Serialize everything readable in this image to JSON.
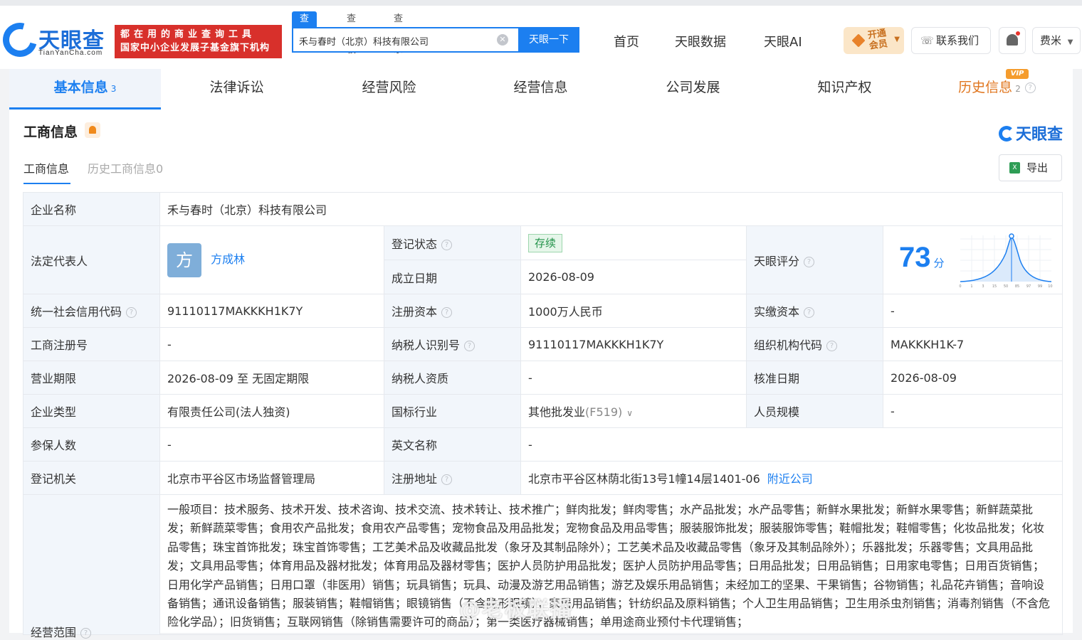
{
  "header": {
    "logo_text": "天眼查",
    "logo_sub": "TianYanCha.com",
    "banner_line1": "都在用的商业查询工具",
    "banner_line2": "国家中小企业发展子基金旗下机构",
    "search_tabs": [
      "查公司",
      "查老板",
      "查关系"
    ],
    "search_value": "禾与春时（北京）科技有限公司",
    "search_button": "天眼一下",
    "nav": [
      "首页",
      "天眼数据",
      "天眼AI"
    ],
    "vip_label_1": "开通",
    "vip_label_2": "会员",
    "contact": "联系我们",
    "user": "费米"
  },
  "tabs": [
    {
      "label": "基本信息",
      "count": "3"
    },
    {
      "label": "法律诉讼"
    },
    {
      "label": "经营风险"
    },
    {
      "label": "经营信息"
    },
    {
      "label": "公司发展"
    },
    {
      "label": "知识产权"
    },
    {
      "label": "历史信息",
      "count": "2",
      "badge": "VIP"
    }
  ],
  "panel": {
    "title": "工商信息",
    "brand": "天眼查",
    "subtabs": [
      "工商信息",
      "历史工商信息0"
    ],
    "export": "导出"
  },
  "info": {
    "company_name_label": "企业名称",
    "company_name": "禾与春时（北京）科技有限公司",
    "legal_rep_label": "法定代表人",
    "legal_rep_avatar": "方",
    "legal_rep": "方成林",
    "reg_status_label": "登记状态",
    "reg_status": "存续",
    "found_date_label": "成立日期",
    "found_date": "2026-08-09",
    "score_label": "天眼评分",
    "score": "73",
    "score_unit": "分",
    "credit_code_label": "统一社会信用代码",
    "credit_code": "91110117MAKKKH1K7Y",
    "reg_capital_label": "注册资本",
    "reg_capital": "1000万人民币",
    "paid_capital_label": "实缴资本",
    "paid_capital": "-",
    "reg_no_label": "工商注册号",
    "reg_no": "-",
    "taxpayer_id_label": "纳税人识别号",
    "taxpayer_id": "91110117MAKKKH1K7Y",
    "org_code_label": "组织机构代码",
    "org_code": "MAKKKH1K-7",
    "term_label": "营业期限",
    "term": "2026-08-09 至 无固定期限",
    "taxpayer_qual_label": "纳税人资质",
    "taxpayer_qual": "-",
    "approve_date_label": "核准日期",
    "approve_date": "2026-08-09",
    "type_label": "企业类型",
    "type": "有限责任公司(法人独资)",
    "industry_label": "国标行业",
    "industry": "其他批发业",
    "industry_code": "(F519)",
    "staff_label": "人员规模",
    "staff": "-",
    "insured_label": "参保人数",
    "insured": "-",
    "english_label": "英文名称",
    "english": "-",
    "authority_label": "登记机关",
    "authority": "北京市平谷区市场监督管理局",
    "address_label": "注册地址",
    "address": "北京市平谷区林荫北街13号1幢14层1401-06",
    "nearby": "附近公司",
    "scope_label": "经营范围",
    "scope": "一般项目：技术服务、技术开发、技术咨询、技术交流、技术转让、技术推广；鲜肉批发；鲜肉零售；水产品批发；水产品零售；新鲜水果批发；新鲜水果零售；新鲜蔬菜批发；新鲜蔬菜零售；食用农产品批发；食用农产品零售；宠物食品及用品批发；宠物食品及用品零售；服装服饰批发；服装服饰零售；鞋帽批发；鞋帽零售；化妆品批发；化妆品零售；珠宝首饰批发；珠宝首饰零售；工艺美术品及收藏品批发（象牙及其制品除外）；工艺美术品及收藏品零售（象牙及其制品除外）；乐器批发；乐器零售；文具用品批发；文具用品零售；体育用品及器材批发；体育用品及器材零售；医护人员防护用品批发；医护人员防护用品零售；日用品批发；日用品销售；日用家电零售；日用百货销售；日用化学产品销售；日用口罩（非医用）销售；玩具销售；玩具、动漫及游艺用品销售；游艺及娱乐用品销售；未经加工的坚果、干果销售；谷物销售；礼品花卉销售；音响设备销售；通讯设备销售；服装销售；鞋帽销售；眼镜销售（不含隐形眼镜）；家居用品销售；针纺织品及原料销售；个人卫生用品销售；卫生用杀虫剂销售；消毒剂销售（不含危险化学品）；旧货销售；互联网销售（除销售需要许可的商品）；第一类医疗器械销售；单用途商业预付卡代理销售；"
  },
  "score_chart": {
    "ticks": [
      "0",
      "1",
      "3",
      "15",
      "50",
      "85",
      "97",
      "99",
      "100"
    ]
  },
  "watermark": "@老板联播",
  "colors": {
    "accent": "#1c7ff0",
    "banner": "#d8302b",
    "status_green": "#23934a",
    "history": "#e0761f"
  }
}
